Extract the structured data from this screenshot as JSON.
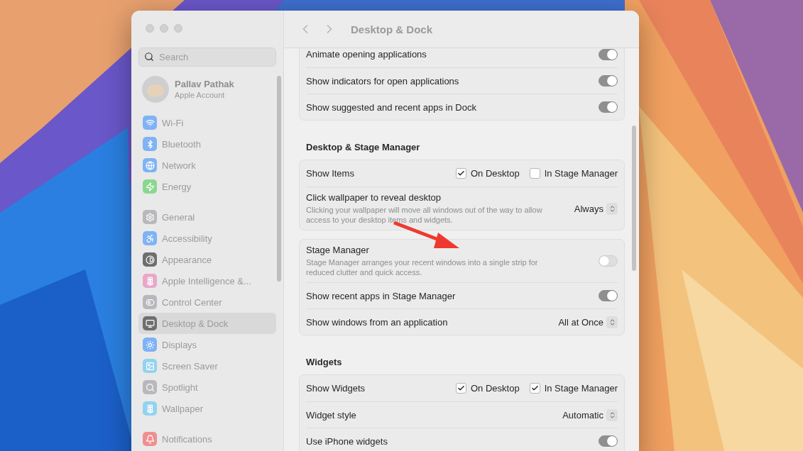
{
  "window": {
    "title": "Desktop & Dock"
  },
  "sidebar": {
    "search": {
      "placeholder": "Search"
    },
    "account": {
      "name": "Pallav Pathak",
      "subtitle": "Apple Account"
    },
    "groups": [
      [
        {
          "label": "Wi-Fi",
          "color": "#7fb3f5",
          "selected": false
        },
        {
          "label": "Bluetooth",
          "color": "#7fb3f5",
          "selected": false
        },
        {
          "label": "Network",
          "color": "#7fb3f5",
          "selected": false
        },
        {
          "label": "Energy",
          "color": "#8ad88f",
          "selected": false
        }
      ],
      [
        {
          "label": "General",
          "color": "#b8b8bc",
          "selected": false
        },
        {
          "label": "Accessibility",
          "color": "#7fb3f5",
          "selected": false
        },
        {
          "label": "Appearance",
          "color": "#6e6e70",
          "selected": false
        },
        {
          "label": "Apple Intelligence &...",
          "color": "#e9a7c9",
          "selected": false
        },
        {
          "label": "Control Center",
          "color": "#b8b8bc",
          "selected": false
        },
        {
          "label": "Desktop & Dock",
          "color": "#6e6e70",
          "selected": true
        },
        {
          "label": "Displays",
          "color": "#7fb3f5",
          "selected": false
        },
        {
          "label": "Screen Saver",
          "color": "#92d3ef",
          "selected": false
        },
        {
          "label": "Spotlight",
          "color": "#b8b8bc",
          "selected": false
        },
        {
          "label": "Wallpaper",
          "color": "#92d3ef",
          "selected": false
        }
      ],
      [
        {
          "label": "Notifications",
          "color": "#f08f8f",
          "selected": false
        }
      ]
    ]
  },
  "sections": [
    {
      "rows": [
        {
          "kind": "toggle",
          "label": "Animate opening applications",
          "on": true
        },
        {
          "kind": "toggle",
          "label": "Show indicators for open applications",
          "on": true
        },
        {
          "kind": "toggle",
          "label": "Show suggested and recent apps in Dock",
          "on": true
        }
      ]
    },
    {
      "heading": "Desktop & Stage Manager",
      "rows": [
        {
          "kind": "checks",
          "label": "Show Items",
          "options": [
            {
              "label": "On Desktop",
              "checked": true
            },
            {
              "label": "In Stage Manager",
              "checked": false
            }
          ]
        },
        {
          "kind": "popup",
          "label": "Click wallpaper to reveal desktop",
          "description": "Clicking your wallpaper will move all windows out of the way to allow access to your desktop items and widgets.",
          "value": "Always"
        }
      ]
    },
    {
      "rows": [
        {
          "kind": "toggle",
          "label": "Stage Manager",
          "description": "Stage Manager arranges your recent windows into a single strip for reduced clutter and quick access.",
          "on": false
        },
        {
          "kind": "toggle",
          "label": "Show recent apps in Stage Manager",
          "on": true
        },
        {
          "kind": "popup",
          "label": "Show windows from an application",
          "value": "All at Once"
        }
      ]
    },
    {
      "heading": "Widgets",
      "rows": [
        {
          "kind": "checks",
          "label": "Show Widgets",
          "options": [
            {
              "label": "On Desktop",
              "checked": true
            },
            {
              "label": "In Stage Manager",
              "checked": true
            }
          ]
        },
        {
          "kind": "popup",
          "label": "Widget style",
          "value": "Automatic"
        },
        {
          "kind": "toggle",
          "label": "Use iPhone widgets",
          "on": true
        }
      ]
    }
  ]
}
